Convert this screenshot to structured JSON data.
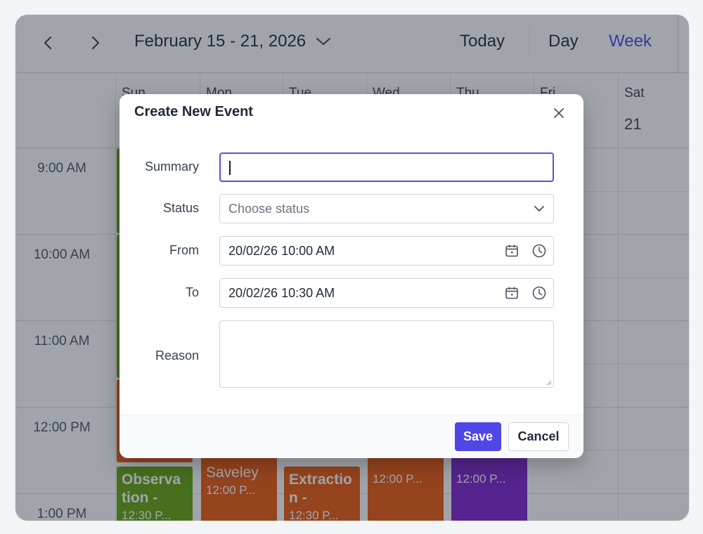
{
  "toolbar": {
    "prev_label": "‹",
    "next_label": "›",
    "date_range": "February 15 - 21, 2026",
    "today_label": "Today",
    "day_label": "Day",
    "week_label": "Week"
  },
  "calendar": {
    "days": [
      {
        "name": "Sun",
        "date": ""
      },
      {
        "name": "Mon",
        "date": ""
      },
      {
        "name": "Tue",
        "date": ""
      },
      {
        "name": "Wed",
        "date": ""
      },
      {
        "name": "Thu",
        "date": ""
      },
      {
        "name": "Fri",
        "date": ""
      },
      {
        "name": "Sat",
        "date": "21"
      }
    ],
    "times": [
      "9:00 AM",
      "10:00 AM",
      "11:00 AM",
      "12:00 PM",
      "1:00 PM"
    ],
    "events": [
      {
        "title": "Observa tion -",
        "time": "12:30 P...",
        "color": "#65a30d"
      },
      {
        "title": "Saveley",
        "time": "12:00 P...",
        "color": "#ea580c"
      },
      {
        "title": "Extractio n -",
        "time": "12:30 P...",
        "color": "#ea580c"
      },
      {
        "title": "",
        "time": "12:00 P...",
        "color": "#ea580c"
      },
      {
        "title": "",
        "time": "12:00 P...",
        "color": "#7e22ce"
      }
    ]
  },
  "modal": {
    "title": "Create New Event",
    "fields": {
      "summary_label": "Summary",
      "summary_value": "",
      "status_label": "Status",
      "status_placeholder": "Choose status",
      "from_label": "From",
      "from_value": "20/02/26 10:00 AM",
      "to_label": "To",
      "to_value": "20/02/26 10:30 AM",
      "reason_label": "Reason",
      "reason_value": ""
    },
    "save_label": "Save",
    "cancel_label": "Cancel"
  },
  "colors": {
    "accent": "#4f46e5",
    "green_event": "#65a30d",
    "orange_event": "#ea580c",
    "purple_event": "#7e22ce"
  },
  "icons": [
    "chevron-left-icon",
    "chevron-right-icon",
    "chevron-down-icon",
    "close-icon",
    "calendar-icon",
    "clock-icon"
  ]
}
